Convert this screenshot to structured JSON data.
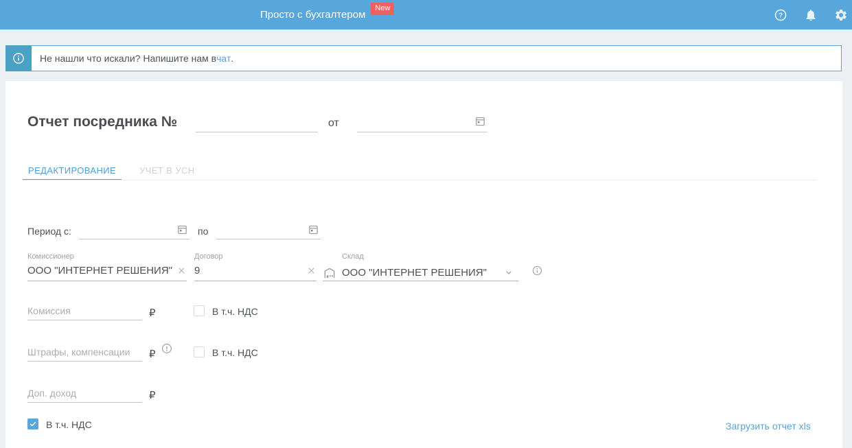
{
  "header": {
    "title": "Просто с бухгалтером",
    "badge": "New"
  },
  "banner": {
    "text_before": "Не нашли что искали? Напишите нам в ",
    "link_label": "чат",
    "text_after": "."
  },
  "report": {
    "title": "Отчет посредника №",
    "number_value": "",
    "from_label": "от",
    "date_value": ""
  },
  "tabs": [
    {
      "label": "РЕДАКТИРОВАНИЕ",
      "active": true
    },
    {
      "label": "УЧЕТ В УСН",
      "active": false
    }
  ],
  "period": {
    "label": "Период с:",
    "to_label": "по",
    "from_value": "",
    "to_value": ""
  },
  "fields": {
    "commissioner": {
      "label": "Комиссионер",
      "value": "ООО \"ИНТЕРНЕТ РЕШЕНИЯ\""
    },
    "contract": {
      "label": "Договор",
      "value": "9"
    },
    "warehouse": {
      "label": "Склад",
      "value": "ООО \"ИНТЕРНЕТ РЕШЕНИЯ\""
    }
  },
  "amounts": {
    "currency": "₽",
    "vat_label": "В т.ч. НДС",
    "commission": {
      "placeholder": "Комиссия",
      "vat_checked": false
    },
    "penalties": {
      "placeholder": "Штрафы, компенсации",
      "vat_checked": false
    },
    "extra_income": {
      "placeholder": "Доп. доход"
    },
    "total_vat_checked": true
  },
  "footer": {
    "upload_link": "Загрузить отчет xls"
  },
  "icons": {
    "help": "?",
    "bell": "bell",
    "gear": "gear",
    "info": "i",
    "calendar": "calendar",
    "clear": "×",
    "chevron_down": "⌄",
    "warning": "!",
    "warehouse": "building",
    "check": "✓"
  },
  "colors": {
    "header_bg": "#57a7dc",
    "badge_red": "#ee6161",
    "banner_accent": "#4ba1c3",
    "link_blue": "#58a0d9",
    "tab_active": "#4a9fdd",
    "checkbox_checked": "#57a7dc"
  }
}
